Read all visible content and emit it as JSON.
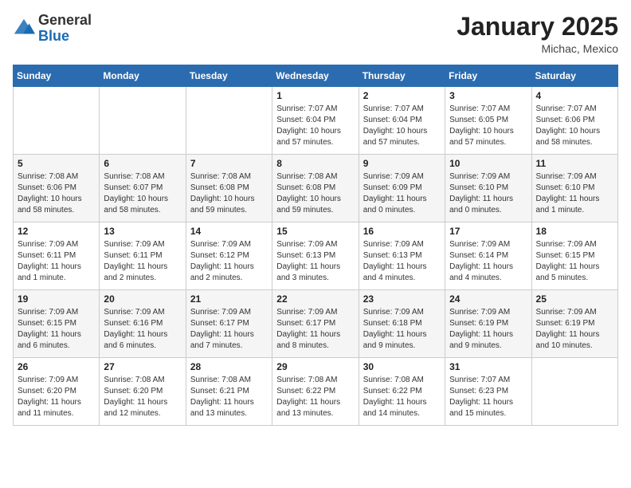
{
  "header": {
    "logo": {
      "general": "General",
      "blue": "Blue"
    },
    "title": "January 2025",
    "location": "Michac, Mexico"
  },
  "calendar": {
    "days_of_week": [
      "Sunday",
      "Monday",
      "Tuesday",
      "Wednesday",
      "Thursday",
      "Friday",
      "Saturday"
    ],
    "weeks": [
      [
        {
          "day": "",
          "info": ""
        },
        {
          "day": "",
          "info": ""
        },
        {
          "day": "",
          "info": ""
        },
        {
          "day": "1",
          "info": "Sunrise: 7:07 AM\nSunset: 6:04 PM\nDaylight: 10 hours\nand 57 minutes."
        },
        {
          "day": "2",
          "info": "Sunrise: 7:07 AM\nSunset: 6:04 PM\nDaylight: 10 hours\nand 57 minutes."
        },
        {
          "day": "3",
          "info": "Sunrise: 7:07 AM\nSunset: 6:05 PM\nDaylight: 10 hours\nand 57 minutes."
        },
        {
          "day": "4",
          "info": "Sunrise: 7:07 AM\nSunset: 6:06 PM\nDaylight: 10 hours\nand 58 minutes."
        }
      ],
      [
        {
          "day": "5",
          "info": "Sunrise: 7:08 AM\nSunset: 6:06 PM\nDaylight: 10 hours\nand 58 minutes."
        },
        {
          "day": "6",
          "info": "Sunrise: 7:08 AM\nSunset: 6:07 PM\nDaylight: 10 hours\nand 58 minutes."
        },
        {
          "day": "7",
          "info": "Sunrise: 7:08 AM\nSunset: 6:08 PM\nDaylight: 10 hours\nand 59 minutes."
        },
        {
          "day": "8",
          "info": "Sunrise: 7:08 AM\nSunset: 6:08 PM\nDaylight: 10 hours\nand 59 minutes."
        },
        {
          "day": "9",
          "info": "Sunrise: 7:09 AM\nSunset: 6:09 PM\nDaylight: 11 hours\nand 0 minutes."
        },
        {
          "day": "10",
          "info": "Sunrise: 7:09 AM\nSunset: 6:10 PM\nDaylight: 11 hours\nand 0 minutes."
        },
        {
          "day": "11",
          "info": "Sunrise: 7:09 AM\nSunset: 6:10 PM\nDaylight: 11 hours\nand 1 minute."
        }
      ],
      [
        {
          "day": "12",
          "info": "Sunrise: 7:09 AM\nSunset: 6:11 PM\nDaylight: 11 hours\nand 1 minute."
        },
        {
          "day": "13",
          "info": "Sunrise: 7:09 AM\nSunset: 6:11 PM\nDaylight: 11 hours\nand 2 minutes."
        },
        {
          "day": "14",
          "info": "Sunrise: 7:09 AM\nSunset: 6:12 PM\nDaylight: 11 hours\nand 2 minutes."
        },
        {
          "day": "15",
          "info": "Sunrise: 7:09 AM\nSunset: 6:13 PM\nDaylight: 11 hours\nand 3 minutes."
        },
        {
          "day": "16",
          "info": "Sunrise: 7:09 AM\nSunset: 6:13 PM\nDaylight: 11 hours\nand 4 minutes."
        },
        {
          "day": "17",
          "info": "Sunrise: 7:09 AM\nSunset: 6:14 PM\nDaylight: 11 hours\nand 4 minutes."
        },
        {
          "day": "18",
          "info": "Sunrise: 7:09 AM\nSunset: 6:15 PM\nDaylight: 11 hours\nand 5 minutes."
        }
      ],
      [
        {
          "day": "19",
          "info": "Sunrise: 7:09 AM\nSunset: 6:15 PM\nDaylight: 11 hours\nand 6 minutes."
        },
        {
          "day": "20",
          "info": "Sunrise: 7:09 AM\nSunset: 6:16 PM\nDaylight: 11 hours\nand 6 minutes."
        },
        {
          "day": "21",
          "info": "Sunrise: 7:09 AM\nSunset: 6:17 PM\nDaylight: 11 hours\nand 7 minutes."
        },
        {
          "day": "22",
          "info": "Sunrise: 7:09 AM\nSunset: 6:17 PM\nDaylight: 11 hours\nand 8 minutes."
        },
        {
          "day": "23",
          "info": "Sunrise: 7:09 AM\nSunset: 6:18 PM\nDaylight: 11 hours\nand 9 minutes."
        },
        {
          "day": "24",
          "info": "Sunrise: 7:09 AM\nSunset: 6:19 PM\nDaylight: 11 hours\nand 9 minutes."
        },
        {
          "day": "25",
          "info": "Sunrise: 7:09 AM\nSunset: 6:19 PM\nDaylight: 11 hours\nand 10 minutes."
        }
      ],
      [
        {
          "day": "26",
          "info": "Sunrise: 7:09 AM\nSunset: 6:20 PM\nDaylight: 11 hours\nand 11 minutes."
        },
        {
          "day": "27",
          "info": "Sunrise: 7:08 AM\nSunset: 6:20 PM\nDaylight: 11 hours\nand 12 minutes."
        },
        {
          "day": "28",
          "info": "Sunrise: 7:08 AM\nSunset: 6:21 PM\nDaylight: 11 hours\nand 13 minutes."
        },
        {
          "day": "29",
          "info": "Sunrise: 7:08 AM\nSunset: 6:22 PM\nDaylight: 11 hours\nand 13 minutes."
        },
        {
          "day": "30",
          "info": "Sunrise: 7:08 AM\nSunset: 6:22 PM\nDaylight: 11 hours\nand 14 minutes."
        },
        {
          "day": "31",
          "info": "Sunrise: 7:07 AM\nSunset: 6:23 PM\nDaylight: 11 hours\nand 15 minutes."
        },
        {
          "day": "",
          "info": ""
        }
      ]
    ]
  }
}
